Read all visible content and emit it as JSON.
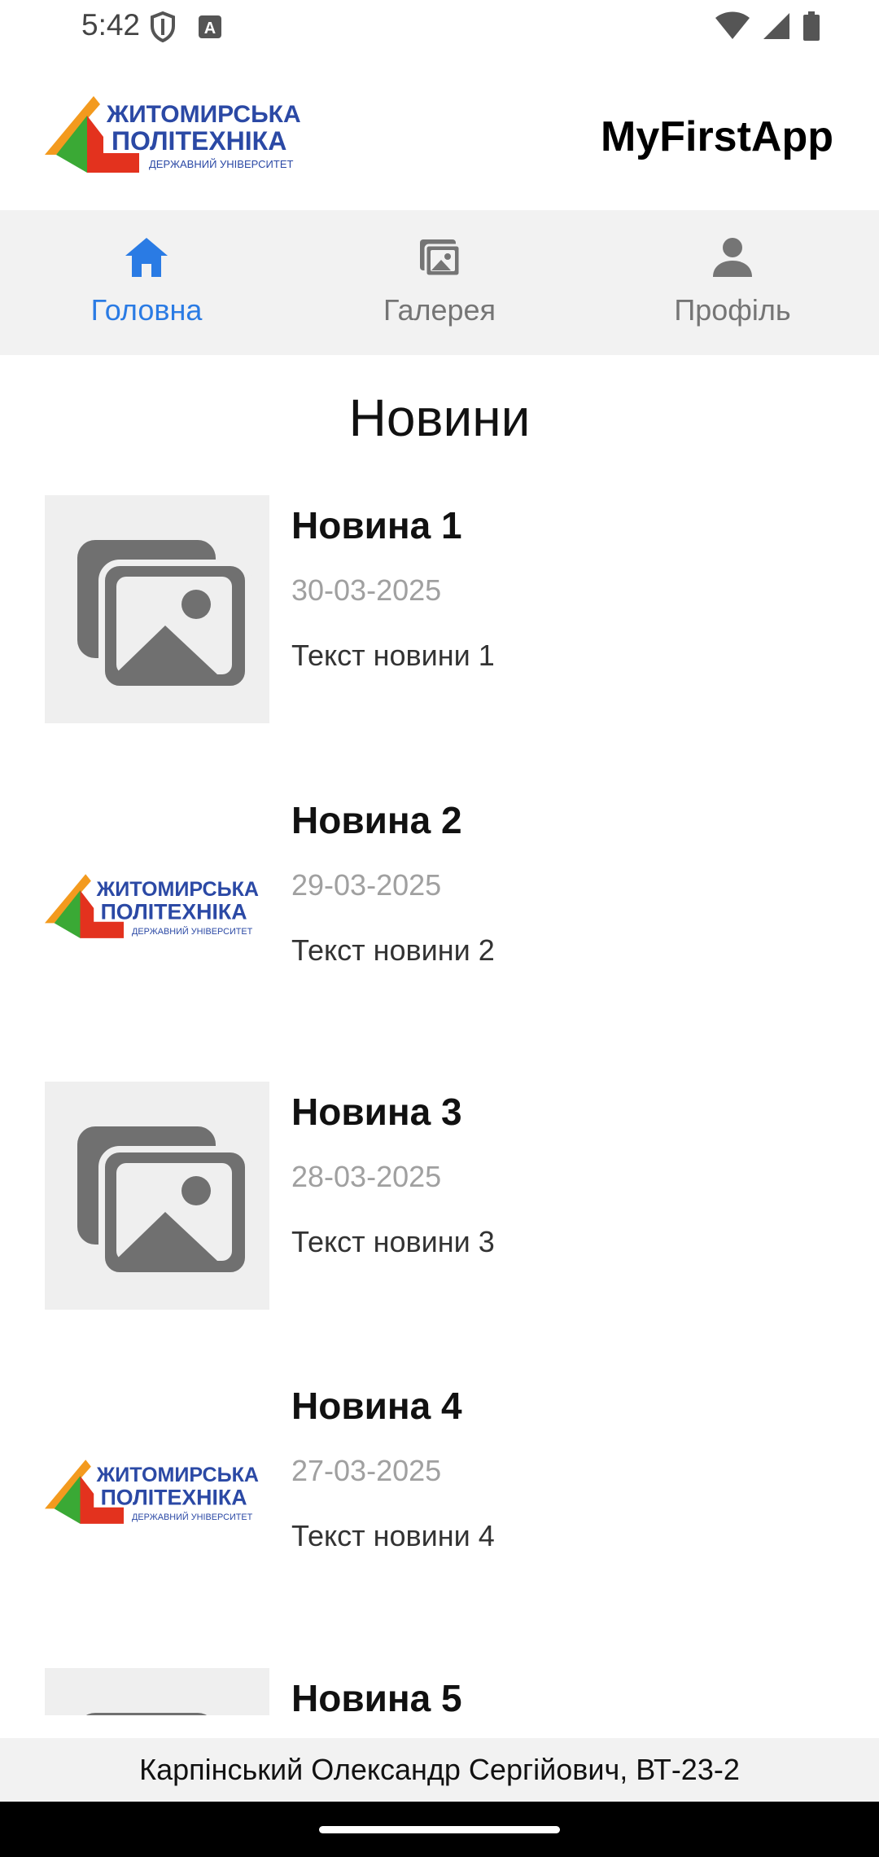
{
  "status_bar": {
    "time": "5:42",
    "icons": [
      "shield-icon",
      "keyboard-a-icon",
      "wifi-icon",
      "signal-icon",
      "battery-icon"
    ]
  },
  "header": {
    "logo": {
      "line1": "ЖИТОМИРСЬКА",
      "line2": "ПОЛІТЕХНІКА",
      "line3": "ДЕРЖАВНИЙ УНІВЕРСИТЕТ"
    },
    "title": "MyFirstApp"
  },
  "tabs": [
    {
      "label": "Головна",
      "icon": "home-icon",
      "active": true
    },
    {
      "label": "Галерея",
      "icon": "gallery-icon",
      "active": false
    },
    {
      "label": "Профіль",
      "icon": "person-icon",
      "active": false
    }
  ],
  "section_title": "Новини",
  "news": [
    {
      "title": "Новина 1",
      "date": "30-03-2025",
      "text": "Текст новини 1",
      "image": "placeholder"
    },
    {
      "title": "Новина 2",
      "date": "29-03-2025",
      "text": "Текст новини 2",
      "image": "logo"
    },
    {
      "title": "Новина 3",
      "date": "28-03-2025",
      "text": "Текст новини 3",
      "image": "placeholder"
    },
    {
      "title": "Новина 4",
      "date": "27-03-2025",
      "text": "Текст новини 4",
      "image": "logo"
    },
    {
      "title": "Новина 5",
      "date": "",
      "text": "",
      "image": "placeholder"
    }
  ],
  "footer": {
    "text": "Карпінський Олександр Сергійович, ВТ-23-2"
  },
  "colors": {
    "accent": "#2a7be4",
    "tab_bar_bg": "#f2f2f2",
    "inactive": "#757575",
    "logo_blue": "#2b49a5",
    "logo_red": "#e3321e",
    "logo_orange": "#f39a1e",
    "logo_green": "#3aa935"
  }
}
